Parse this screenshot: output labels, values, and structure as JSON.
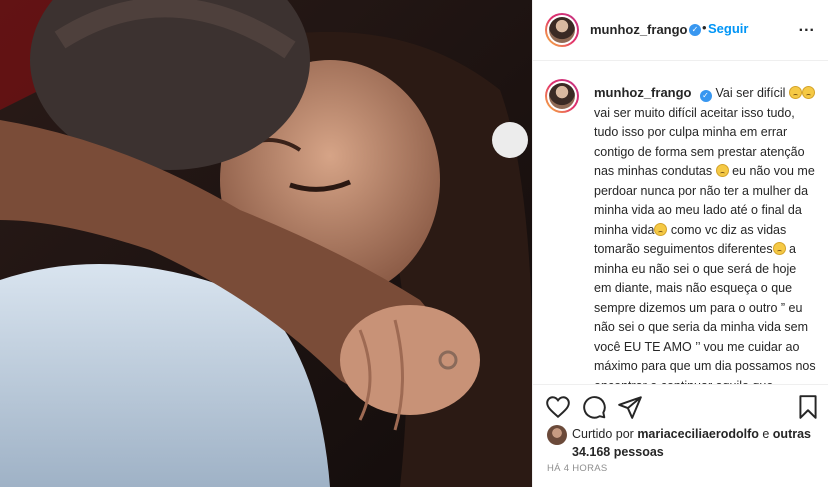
{
  "post": {
    "author": "munhoz_frango",
    "follow_label": "Seguir",
    "separator": "•",
    "more_label": "...",
    "caption_parts": [
      "Vai ser difícil ",
      " vai ser muito difícil aceitar isso tudo, tudo isso por culpa minha em errar contigo de forma sem prestar atenção nas minhas condutas ",
      " eu não vou me perdoar nunca por não ter a mulher da minha vida ao meu lado até o final da minha vida",
      " como vc diz as vidas tomarão seguimentos diferentes",
      " a minha eu não sei o que será de hoje em diante, mais não esqueça o que sempre dizemos um para o outro ” eu não sei o que seria da minha vida sem você EU TE AMO ’’ vou me cuidar ao máximo para que um dia possamos nos encontrar e continuar aquilo que juramos um para o outro, e nunca esqueça minha vida não existe sem você"
    ],
    "likes": {
      "prefix": "Curtido por ",
      "liker": "mariaceciliaerodolfo",
      "middle": " e ",
      "others": "outras 34.168 pessoas"
    },
    "timestamp": "HÁ 4 HORAS"
  },
  "icons": {
    "like": "heart-icon",
    "comment": "comment-icon",
    "share": "paper-plane-icon",
    "save": "bookmark-icon",
    "verified": "verified-badge-icon",
    "emoji": "sad-face-emoji"
  },
  "colors": {
    "link_blue": "#0095f6",
    "verified_blue": "#3897f0",
    "text": "#262626",
    "muted": "#8e8e8e",
    "border": "#efefef"
  }
}
